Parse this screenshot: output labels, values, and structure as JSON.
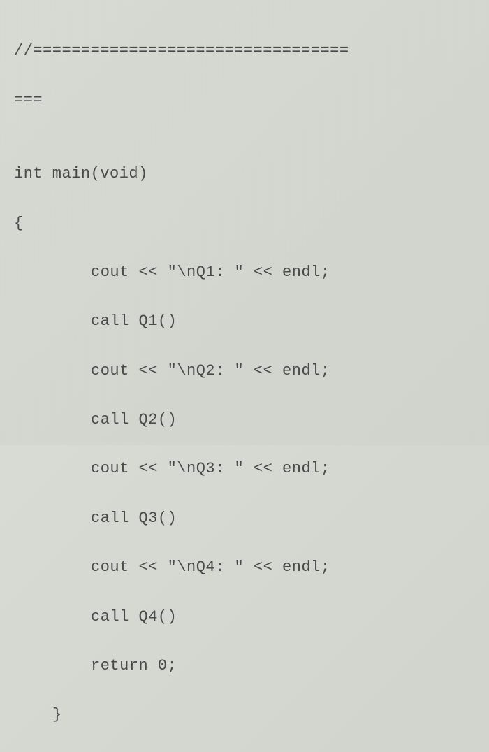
{
  "code": {
    "line1": "//=================================",
    "line2": "===",
    "line3": "",
    "line4": "int main(void)",
    "line5": "{",
    "line6": "cout << \"\\nQ1: \" << endl;",
    "line7": "call Q1()",
    "line8": "cout << \"\\nQ2: \" << endl;",
    "line9": "call Q2()",
    "line10": "cout << \"\\nQ3: \" << endl;",
    "line11": "call Q3()",
    "line12": "cout << \"\\nQ4: \" << endl;",
    "line13": "call Q4()",
    "line14": "return 0;",
    "line15": "}"
  }
}
